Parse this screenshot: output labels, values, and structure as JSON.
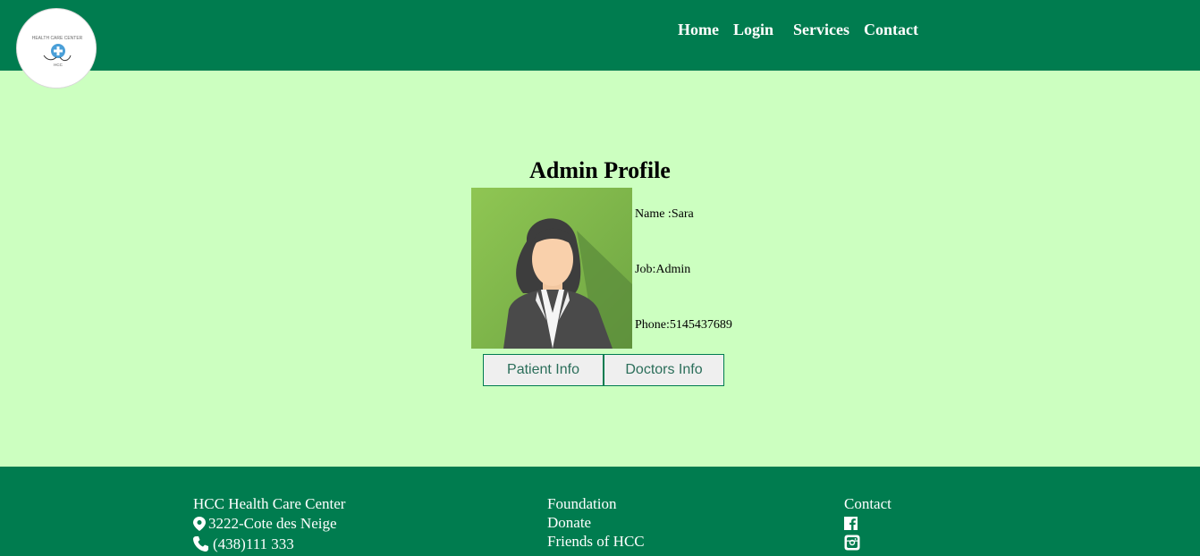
{
  "logo": {
    "alt": "HEALTH CARE CENTER",
    "initials": "HCC"
  },
  "nav": {
    "home": "Home",
    "login": "Login",
    "services": "Services",
    "contact": "Contact"
  },
  "profile": {
    "title": "Admin Profile",
    "name": "Name :Sara",
    "job": "Job:Admin",
    "phone": "Phone:5145437689"
  },
  "buttons": {
    "patient_info": "Patient Info",
    "doctors_info": "Doctors Info"
  },
  "footer": {
    "col1": {
      "title": "HCC Health Care Center",
      "address": "3222-Cote des Neige",
      "phone": "(438)111 333"
    },
    "col2": {
      "foundation": "Foundation",
      "donate": "Donate",
      "friends": "Friends of HCC"
    },
    "col3": {
      "title": "Contact"
    }
  },
  "icons": {
    "location": "location-pin-icon",
    "phone": "phone-icon",
    "facebook": "facebook-icon",
    "instagram": "instagram-icon"
  },
  "colors": {
    "header": "#007c4f",
    "background": "#ccffc0",
    "footer": "#007c4f",
    "button_bg": "#efefef",
    "button_text": "#2b6e5a"
  }
}
